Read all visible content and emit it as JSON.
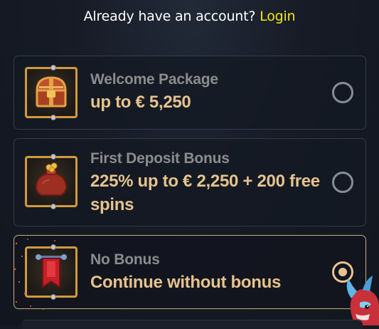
{
  "header": {
    "prompt": "Already have an account?",
    "login_link": "Login",
    "login_color": "#f7e614"
  },
  "bonus_options": [
    {
      "title": "Welcome Package",
      "subtitle": "up to € 5,250",
      "icon": "treasure-chest-icon",
      "selected": false
    },
    {
      "title": "First Deposit Bonus",
      "subtitle": "225% up to € 2,250 + 200 free spins",
      "icon": "money-bag-icon",
      "selected": false
    },
    {
      "title": "No Bonus",
      "subtitle": "Continue without bonus",
      "icon": "banner-flag-icon",
      "selected": true
    }
  ],
  "colors": {
    "title_gray": "#8c8c8c",
    "subtitle_gold": "#e6c38e",
    "selected_border": "#c9ad7a",
    "icon_frame": "#d29a3d",
    "background": "#161b26"
  }
}
